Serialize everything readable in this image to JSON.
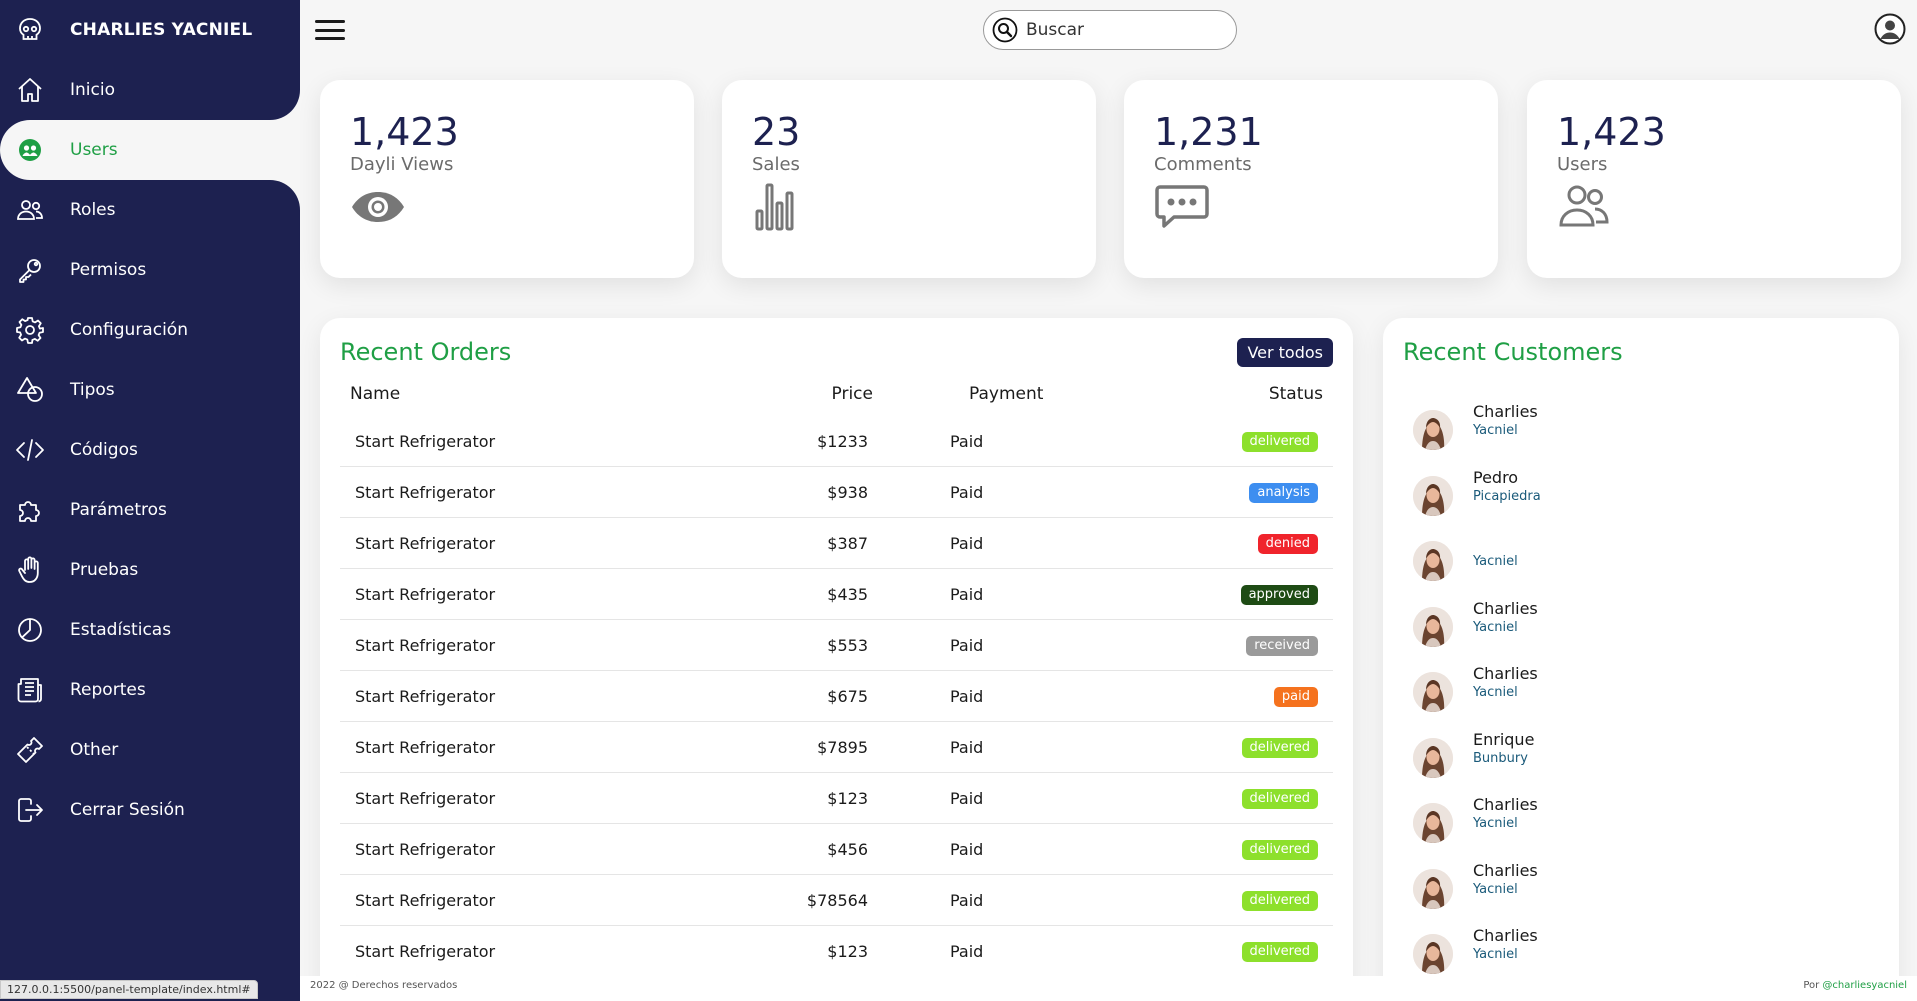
{
  "sidebar": {
    "brand": "CHARLIES YACNIEL",
    "items": [
      {
        "label": "Inicio",
        "icon": "home-icon"
      },
      {
        "label": "Users",
        "icon": "users-icon"
      },
      {
        "label": "Roles",
        "icon": "people-icon"
      },
      {
        "label": "Permisos",
        "icon": "key-icon"
      },
      {
        "label": "Configuración",
        "icon": "gear-icon"
      },
      {
        "label": "Tipos",
        "icon": "shapes-icon"
      },
      {
        "label": "Códigos",
        "icon": "code-icon"
      },
      {
        "label": "Parámetros",
        "icon": "puzzle-icon"
      },
      {
        "label": "Pruebas",
        "icon": "hand-icon"
      },
      {
        "label": "Estadísticas",
        "icon": "pie-chart-icon"
      },
      {
        "label": "Reportes",
        "icon": "newspaper-icon"
      },
      {
        "label": "Other",
        "icon": "ticket-icon"
      },
      {
        "label": "Cerrar Sesión",
        "icon": "logout-icon"
      }
    ],
    "active_index": 1
  },
  "topbar": {
    "search_placeholder": "Buscar"
  },
  "cards": [
    {
      "value": "1,423",
      "label": "Dayli Views",
      "icon": "eye-icon"
    },
    {
      "value": "23",
      "label": "Sales",
      "icon": "bar-chart-icon"
    },
    {
      "value": "1,231",
      "label": "Comments",
      "icon": "chat-icon"
    },
    {
      "value": "1,423",
      "label": "Users",
      "icon": "people-icon"
    }
  ],
  "orders": {
    "title": "Recent Orders",
    "view_all": "Ver todos",
    "headers": {
      "name": "Name",
      "price": "Price",
      "payment": "Payment",
      "status": "Status"
    },
    "rows": [
      {
        "name": "Start Refrigerator",
        "price": "$1233",
        "payment": "Paid",
        "status": "delivered"
      },
      {
        "name": "Start Refrigerator",
        "price": "$938",
        "payment": "Paid",
        "status": "analysis"
      },
      {
        "name": "Start Refrigerator",
        "price": "$387",
        "payment": "Paid",
        "status": "denied"
      },
      {
        "name": "Start Refrigerator",
        "price": "$435",
        "payment": "Paid",
        "status": "approved"
      },
      {
        "name": "Start Refrigerator",
        "price": "$553",
        "payment": "Paid",
        "status": "received"
      },
      {
        "name": "Start Refrigerator",
        "price": "$675",
        "payment": "Paid",
        "status": "paid"
      },
      {
        "name": "Start Refrigerator",
        "price": "$7895",
        "payment": "Paid",
        "status": "delivered"
      },
      {
        "name": "Start Refrigerator",
        "price": "$123",
        "payment": "Paid",
        "status": "delivered"
      },
      {
        "name": "Start Refrigerator",
        "price": "$456",
        "payment": "Paid",
        "status": "delivered"
      },
      {
        "name": "Start Refrigerator",
        "price": "$78564",
        "payment": "Paid",
        "status": "delivered"
      },
      {
        "name": "Start Refrigerator",
        "price": "$123",
        "payment": "Paid",
        "status": "delivered"
      }
    ]
  },
  "status_colors": {
    "delivered": "#8de02c",
    "analysis": "#3d8ef0",
    "denied": "#f0242c",
    "approved": "#1e4b14",
    "received": "#9a9a9a",
    "paid": "#f5721e"
  },
  "customers": {
    "title": "Recent Customers",
    "list": [
      {
        "first": "Charlies",
        "last": "Yacniel"
      },
      {
        "first": "Pedro",
        "last": "Picapiedra"
      },
      {
        "first": "",
        "last": "Yacniel"
      },
      {
        "first": "Charlies",
        "last": "Yacniel"
      },
      {
        "first": "Charlies",
        "last": "Yacniel"
      },
      {
        "first": "Enrique",
        "last": "Bunbury"
      },
      {
        "first": "Charlies",
        "last": "Yacniel"
      },
      {
        "first": "Charlies",
        "last": "Yacniel"
      },
      {
        "first": "Charlies",
        "last": "Yacniel"
      }
    ]
  },
  "footer": {
    "left": "2022 @ Derechos reservados",
    "right_prefix": "Por",
    "right_handle": "@charliesyacniel"
  },
  "browser_status_url": "127.0.0.1:5500/panel-template/index.html#",
  "colors": {
    "sidebar": "#1d2150",
    "accent_green": "#1f9f45"
  }
}
